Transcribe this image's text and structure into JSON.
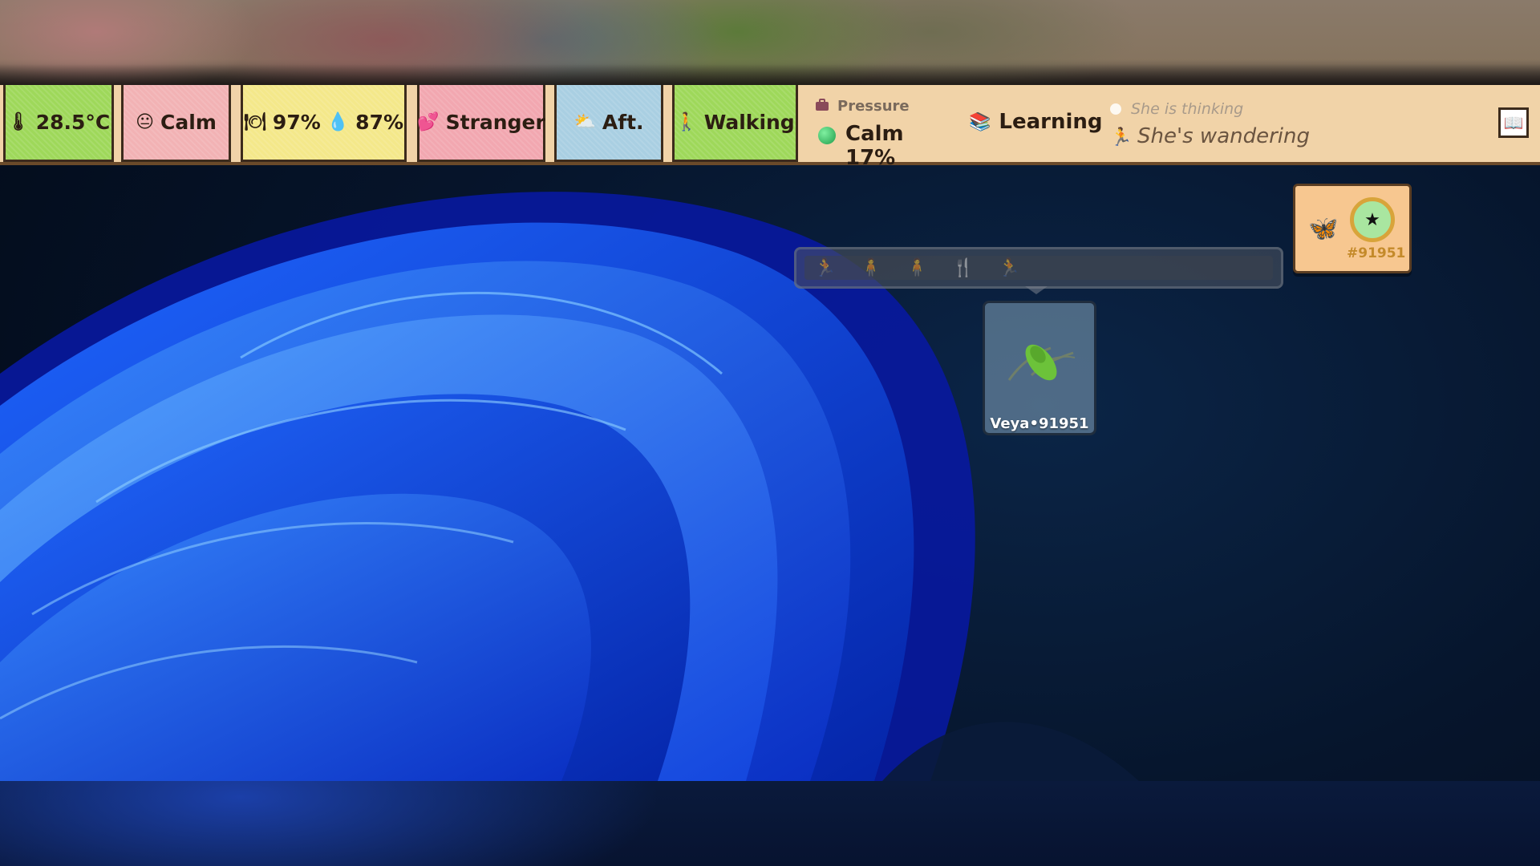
{
  "status_bar": {
    "temperature": {
      "value": "28.5°C",
      "icon": "thermometer-icon"
    },
    "mood": {
      "value": "Calm",
      "icon": "face-icon"
    },
    "needs": {
      "hunger": "97%",
      "hunger_icon": "plate-icon",
      "thirst": "87%",
      "thirst_icon": "water-drop-icon"
    },
    "relationship": {
      "value": "Stranger",
      "icon": "heart-icon"
    },
    "time_of_day": {
      "value": "Aft.",
      "icon": "sun-cloud-icon"
    },
    "activity": {
      "value": "Walking",
      "icon": "walking-icon"
    },
    "pressure": {
      "label": "Pressure",
      "value": "Calm 17%",
      "icon": "briefcase-icon"
    },
    "skill": {
      "value": "Learning",
      "icon": "books-icon"
    },
    "thought": {
      "thinking": "She is thinking",
      "state": "She's wandering",
      "state_icon": "running-icon"
    },
    "journal_icon": "book-icon"
  },
  "pet_badge": {
    "id": "#91951",
    "icon": "butterfly-icon",
    "star": "★"
  },
  "pet_card": {
    "name": "Veya•91951"
  },
  "colors": {
    "status_bar_bg": "#f1d3a8",
    "tile_green": "#9ed85a",
    "tile_pink": "#f2b2b4",
    "tile_yellow": "#f4e88a",
    "tile_blue": "#a9cfe2",
    "badge_bg": "#f7c790"
  }
}
